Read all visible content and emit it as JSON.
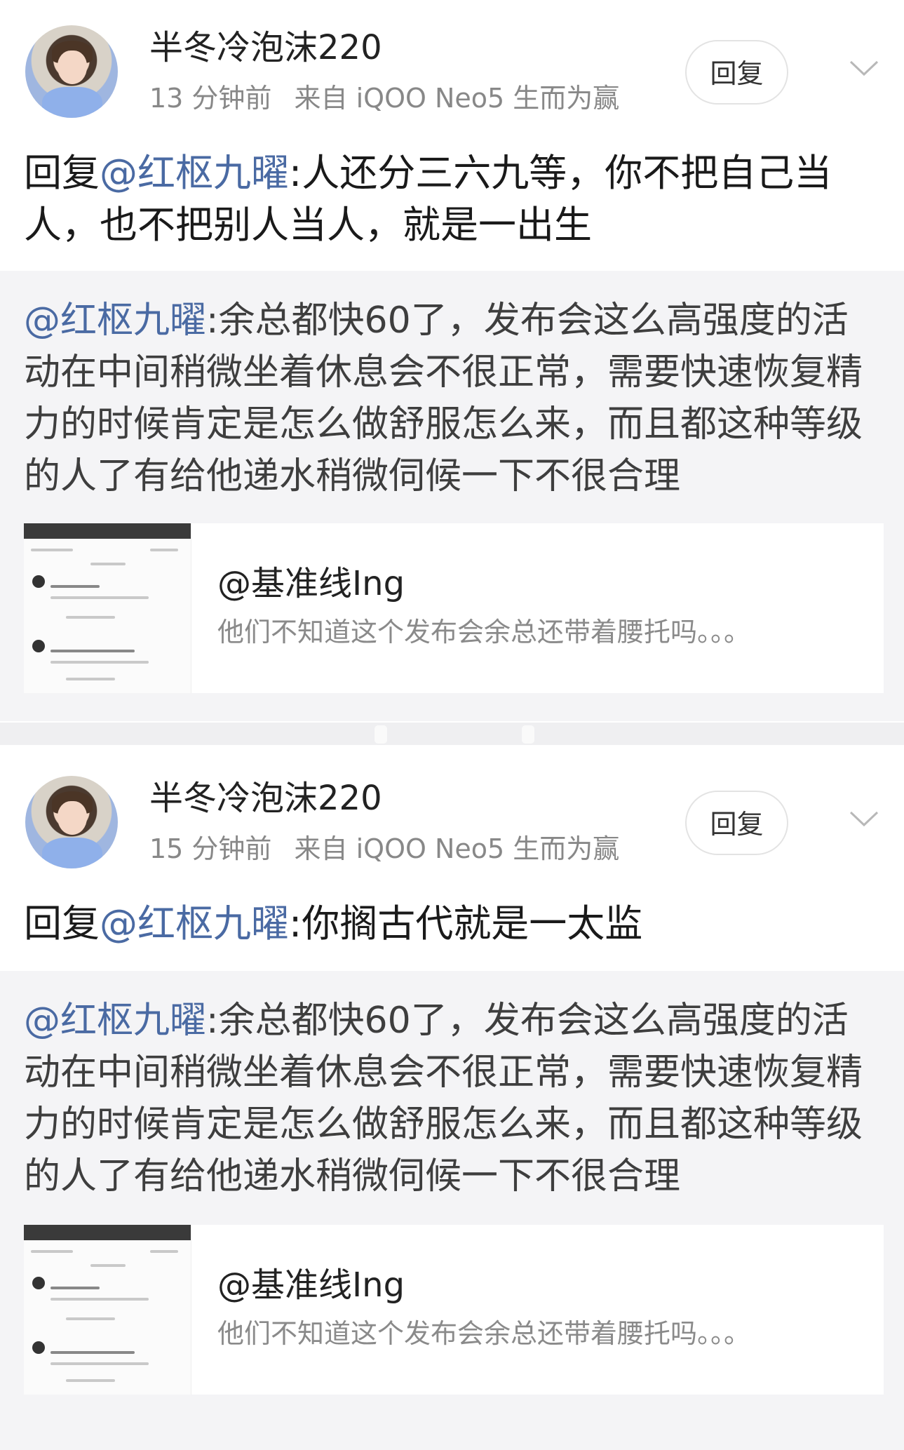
{
  "posts": [
    {
      "username": "半冬冷泡沫220",
      "time": "13 分钟前",
      "source": "来自 iQOO Neo5 生而为赢",
      "reply_button": "回复",
      "reply_prefix": "回复",
      "reply_mention": "@红枢九曜",
      "reply_body": ":人还分三六九等，你不把自己当人，也不把别人当人，就是一出生",
      "quote_mention": "@红枢九曜",
      "quote_body": ":余总都快60了，发布会这么高强度的活动在中间稍微坐着休息会不很正常，需要快速恢复精力的时候肯定是怎么做舒服怎么来，而且都这种等级的人了有给他递水稍微伺候一下不很合理",
      "card_title": "@基准线Ing",
      "card_subtitle": "他们不知道这个发布会余总还带着腰托吗。。。"
    },
    {
      "username": "半冬冷泡沫220",
      "time": "15 分钟前",
      "source": "来自 iQOO Neo5 生而为赢",
      "reply_button": "回复",
      "reply_prefix": "回复",
      "reply_mention": "@红枢九曜",
      "reply_body": ":你搁古代就是一太监",
      "quote_mention": "@红枢九曜",
      "quote_body": ":余总都快60了，发布会这么高强度的活动在中间稍微坐着休息会不很正常，需要快速恢复精力的时候肯定是怎么做舒服怎么来，而且都这种等级的人了有给他递水稍微伺候一下不很合理",
      "card_title": "@基准线Ing",
      "card_subtitle": "他们不知道这个发布会余总还带着腰托吗。。。"
    }
  ],
  "colors": {
    "mention": "#4a6aa3",
    "meta": "#888888",
    "quote_bg": "#f4f4f6"
  },
  "icons": {
    "expand": "chevron-down-icon"
  }
}
